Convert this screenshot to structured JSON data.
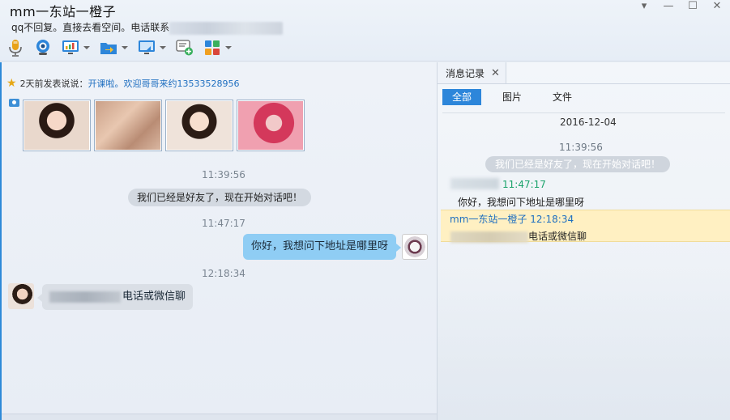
{
  "window": {
    "title": "mm一东站一橙子",
    "status_text": "qq不回复。直接去看空间。电话联系",
    "controls": {
      "menu": "▾",
      "minimize": "—",
      "maximize": "☐",
      "close": "✕"
    }
  },
  "toolbar": {
    "items": [
      {
        "name": "voice-call",
        "icon": "microphone-icon"
      },
      {
        "name": "video-call",
        "icon": "webcam-icon"
      },
      {
        "name": "remote-desktop",
        "icon": "monitor-chart-icon"
      },
      {
        "name": "send-file",
        "icon": "folder-arrow-icon"
      },
      {
        "name": "share-screen",
        "icon": "screen-share-icon"
      },
      {
        "name": "create-discussion",
        "icon": "chat-add-icon"
      },
      {
        "name": "apps",
        "icon": "app-grid-icon"
      }
    ]
  },
  "chat": {
    "feed": {
      "prefix": "2天前发表说说：",
      "link": "开课啦。欢迎哥哥来约13533528956"
    },
    "messages": {
      "ts1": "11:39:56",
      "system": "我们已经是好友了，现在开始对话吧！",
      "ts2": "11:47:17",
      "mine": "你好，我想问下地址是哪里呀",
      "ts3": "12:18:34",
      "theirs_suffix": "电话或微信聊"
    }
  },
  "history": {
    "tab_label": "消息记录",
    "filters": [
      "全部",
      "图片",
      "文件"
    ],
    "date": "2016-12-04",
    "time1": "11:39:56",
    "system": "我们已经是好友了，现在开始对话吧！",
    "time2": "11:47:17",
    "my_text": "你好，我想问下地址是哪里呀",
    "her_header": "mm一东站一橙子 12:18:34",
    "her_suffix": "电话或微信聊"
  },
  "colors": {
    "accent": "#2d86da",
    "my_bubble": "#8fcdf4",
    "link": "#1f6fc0",
    "highlight": "#fff0c2"
  }
}
